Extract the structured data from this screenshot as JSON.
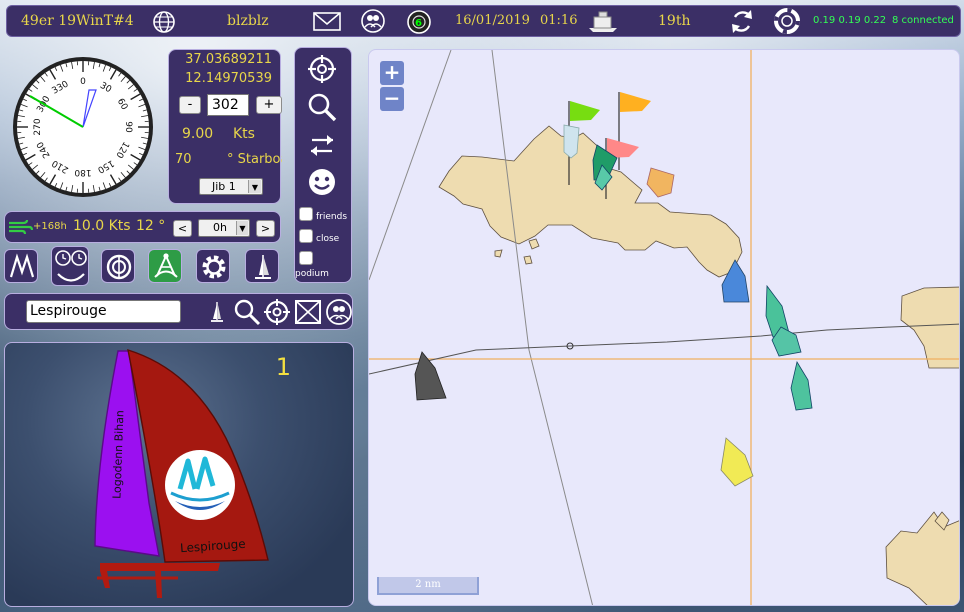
{
  "topbar": {
    "race": "49er 19WinT#4",
    "user": "blzblz",
    "badge": "6",
    "date": "16/01/2019",
    "time": "01:16",
    "rank": "19th",
    "stats": "0.19 0.19 0.22",
    "connected": "8 connected"
  },
  "compass": {
    "labels": [
      "0",
      "30",
      "60",
      "90",
      "120",
      "150",
      "180",
      "210",
      "240",
      "270",
      "300",
      "330"
    ]
  },
  "position": {
    "lat": "37.03689211",
    "lon": "12.14970539",
    "heading": "302",
    "minus_label": "-",
    "plus_label": "+",
    "speed": "9.00",
    "speed_unit": "Kts",
    "twa": "70",
    "twa_unit": "° Starboard",
    "sail": "Jib 1"
  },
  "wind": {
    "forecast": "+168h",
    "speed": "10.0 Kts",
    "angle": "12 °",
    "time_select": "0h",
    "prev_label": "<",
    "next_label": ">"
  },
  "filters": {
    "friends": "friends",
    "close": "close",
    "podium": "podium"
  },
  "search": {
    "value": "Lespirouge"
  },
  "boat_card": {
    "rank": "1",
    "sail_left_text": "Logodenn Bihan",
    "sail_right_text": "Lespirouge",
    "colors": {
      "left_sail": "#9b10f0",
      "right_sail": "#a51810"
    }
  },
  "map": {
    "zoom_in": "+",
    "zoom_out": "−",
    "scale": "2 nm"
  }
}
